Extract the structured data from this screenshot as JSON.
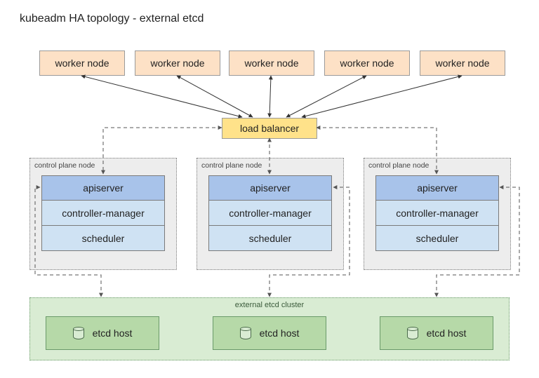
{
  "title": "kubeadm HA topology - external etcd",
  "workers": [
    "worker node",
    "worker node",
    "worker node",
    "worker node",
    "worker node"
  ],
  "load_balancer": "load balancer",
  "cp_label": "control plane node",
  "cp_components": {
    "api": "apiserver",
    "ctrl": "controller-manager",
    "sched": "scheduler"
  },
  "etcd_cluster_label": "external etcd cluster",
  "etcd_host": "etcd host",
  "colors": {
    "worker_bg": "#fde1c6",
    "lb_bg": "#ffe28a",
    "cp_bg": "#ededed",
    "api_bg": "#a8c3ea",
    "comp_bg": "#cfe2f3",
    "etcd_cluster_bg": "#d9ecd3",
    "etcd_host_bg": "#b6d9a8"
  }
}
